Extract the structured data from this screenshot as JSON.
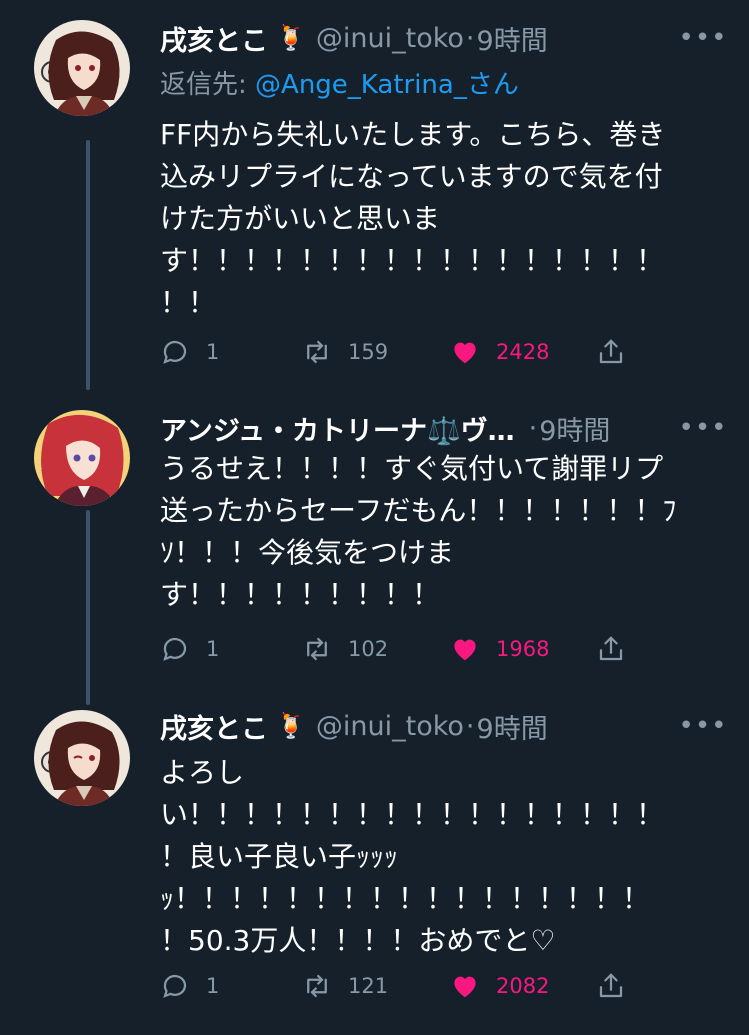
{
  "tweets": [
    {
      "display_name": "戌亥とこ",
      "name_emoji": "🍹",
      "handle": "@inui_toko",
      "separator": "·",
      "time": "9時間",
      "more": "•••",
      "reply_prefix": "返信先: ",
      "reply_mention": "@Ange_Katrina_",
      "reply_suffix": "さん",
      "lines": [
        "FF内から失礼いたします。こちら、巻き",
        "込みリプライになっていますので気を付",
        "けた方がいいと思いま",
        "す！！！！！！！！！！！！！！！！！",
        "！！"
      ],
      "replies": "1",
      "retweets": "159",
      "likes": "2428"
    },
    {
      "display_name": "アンジュ・カトリーナ⚖️ヴ…",
      "handle": "",
      "separator": "·",
      "time": "9時間",
      "more": "•••",
      "lines": [
        "うるせえ！！！！すぐ気付いて謝罪リプ",
        "送ったからセーフだもん！！！！！！！ﾌ",
        "ｿ！！！今後気をつけま",
        "す！！！！！！！！！"
      ],
      "replies": "1",
      "retweets": "102",
      "likes": "1968"
    },
    {
      "display_name": "戌亥とこ",
      "name_emoji": "🍹",
      "handle": "@inui_toko",
      "separator": "·",
      "time": "9時間",
      "more": "•••",
      "lines": [
        "よろし",
        "い！！！！！！！！！！！！！！！！！",
        "！良い子良い子ｯｯｯ",
        "ｯ！！！！！！！！！！！！！！！！！",
        "！50.3万人！！！！おめでと♡"
      ],
      "replies": "1",
      "retweets": "121",
      "likes": "2082"
    }
  ],
  "colors": {
    "background": "#15202b",
    "text": "#ffffff",
    "secondary": "#8899a6",
    "mention": "#1d9bf0",
    "like": "#f91880",
    "thread_line": "#3d5466"
  },
  "icons": [
    "reply-icon",
    "retweet-icon",
    "heart-icon",
    "share-icon",
    "more-icon"
  ]
}
